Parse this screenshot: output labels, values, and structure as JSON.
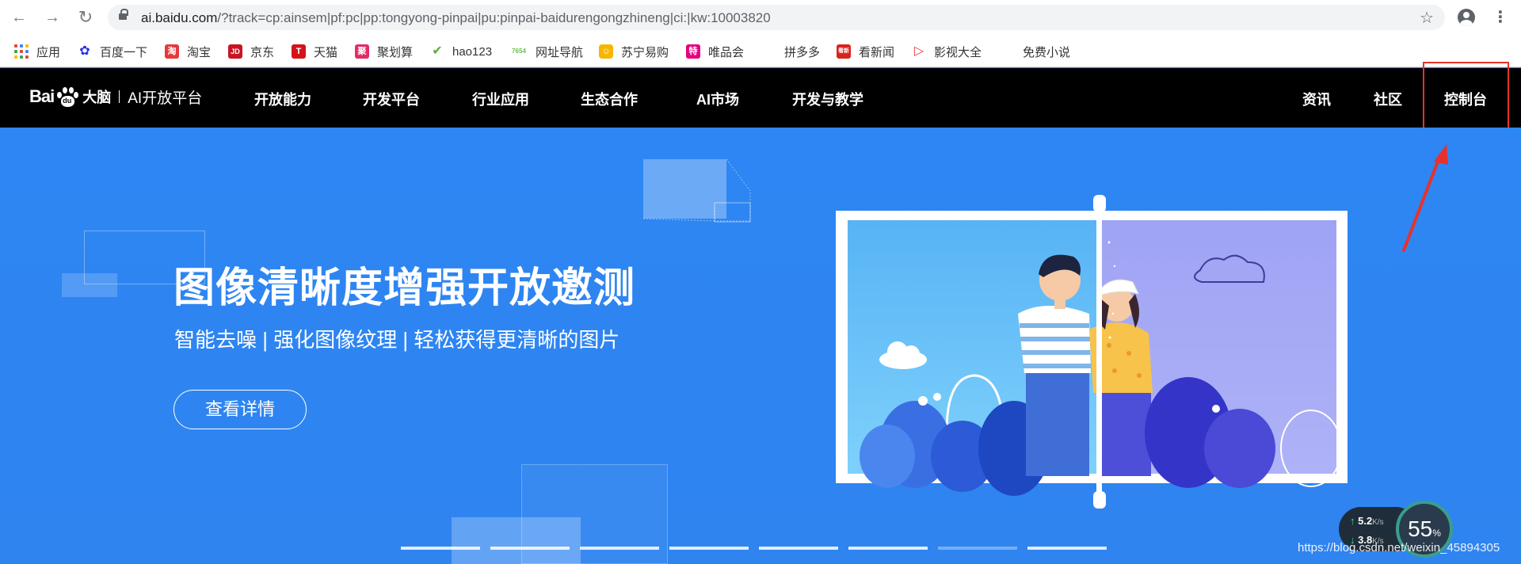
{
  "browser": {
    "url_host": "ai.baidu.com",
    "url_path": "/?track=cp:ainsem|pf:pc|pp:tongyong-pinpai|pu:pinpai-baidurengongzhineng|ci:|kw:10003820",
    "back_icon": "arrow-left-icon",
    "forward_icon": "arrow-right-icon",
    "reload_icon": "reload-icon",
    "star_icon": "star-icon"
  },
  "bookmarks": [
    {
      "label": "应用",
      "icon": "apps-grid-icon",
      "color": "#4285f4"
    },
    {
      "label": "百度一下",
      "icon": "baidu-paw-icon",
      "color": "#2932e1"
    },
    {
      "label": "淘宝",
      "icon": "taobao-icon",
      "color": "#e4393c",
      "glyph": "淘"
    },
    {
      "label": "京东",
      "icon": "jd-icon",
      "color": "#c81623",
      "glyph": "JD"
    },
    {
      "label": "天猫",
      "icon": "tmall-icon",
      "color": "#d4121b",
      "glyph": "T"
    },
    {
      "label": "聚划算",
      "icon": "juhuasuan-icon",
      "color": "#e42c64",
      "glyph": "聚"
    },
    {
      "label": "hao123",
      "icon": "hao123-icon",
      "color": "#5aae3d"
    },
    {
      "label": "网址导航",
      "icon": "7654-icon",
      "color": "#69c14f",
      "glyph": "7654"
    },
    {
      "label": "苏宁易购",
      "icon": "suning-icon",
      "color": "#f7b500"
    },
    {
      "label": "唯品会",
      "icon": "vip-icon",
      "color": "#e4007f",
      "glyph": "特"
    },
    {
      "label": "拼多多",
      "icon": "",
      "color": ""
    },
    {
      "label": "看新闻",
      "icon": "kanxinwen-icon",
      "color": "#d9241c",
      "glyph": "看新"
    },
    {
      "label": "影视大全",
      "icon": "play-icon",
      "color": "#e83838"
    },
    {
      "label": "免费小说",
      "icon": "",
      "color": ""
    }
  ],
  "site": {
    "logo_bai": "Bai",
    "logo_du": "du",
    "logo_brain": "大脑",
    "logo_platform": "AI开放平台",
    "nav": [
      "开放能力",
      "开发平台",
      "行业应用",
      "生态合作",
      "AI市场",
      "开发与教学"
    ],
    "right_nav": [
      "资讯",
      "社区",
      "控制台"
    ]
  },
  "hero": {
    "title": "图像清晰度增强开放邀测",
    "subtitle": "智能去噪 | 强化图像纹理 | 轻松获得更清晰的图片",
    "button": "查看详情",
    "carousel_count": 8,
    "carousel_active": 6
  },
  "speed_widget": {
    "up": "5.2",
    "down": "3.8",
    "unit": "K/s",
    "percent": "55",
    "percent_sign": "%"
  },
  "watermark": "https://blog.csdn.net/weixin_45894305",
  "colors": {
    "hero_bg": "#2f85f2",
    "nav_bg": "#000000",
    "highlight": "#e6322d"
  }
}
